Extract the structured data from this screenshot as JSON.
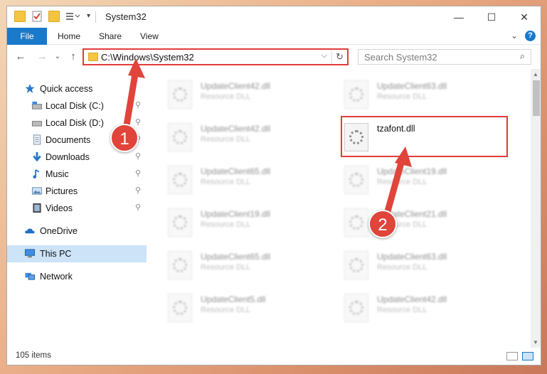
{
  "window": {
    "title": "System32",
    "controls": {
      "minimize": "—",
      "maximize": "☐",
      "close": "✕"
    }
  },
  "ribbon": {
    "file": "File",
    "tabs": [
      "Home",
      "Share",
      "View"
    ],
    "expand": "⌄",
    "help": "?"
  },
  "address_bar": {
    "path": "C:\\Windows\\System32",
    "dropdown": "⌵",
    "refresh": "↻"
  },
  "nav_buttons": {
    "back": "←",
    "forward": "→",
    "recent": "⌄",
    "up": "↑"
  },
  "search": {
    "placeholder": "Search System32",
    "icon": "⌕"
  },
  "sidebar": {
    "pin_glyph": "📌",
    "items": [
      {
        "label": "Quick access",
        "icon": "star-icon",
        "pinned": false
      },
      {
        "label": "Local Disk (C:)",
        "icon": "drive-icon",
        "pinned": true
      },
      {
        "label": "Local Disk (D:)",
        "icon": "drive-icon",
        "pinned": true
      },
      {
        "label": "Documents",
        "icon": "documents-icon",
        "pinned": true
      },
      {
        "label": "Downloads",
        "icon": "download-icon",
        "pinned": true
      },
      {
        "label": "Music",
        "icon": "music-icon",
        "pinned": true
      },
      {
        "label": "Pictures",
        "icon": "pictures-icon",
        "pinned": true
      },
      {
        "label": "Videos",
        "icon": "videos-icon",
        "pinned": true
      },
      {
        "label": "OneDrive",
        "icon": "cloud-icon",
        "pinned": false
      },
      {
        "label": "This PC",
        "icon": "computer-icon",
        "pinned": false,
        "selected": true
      },
      {
        "label": "Network",
        "icon": "network-icon",
        "pinned": false
      }
    ]
  },
  "files": {
    "left_column": [
      {
        "name": "UpdateClient42.dll",
        "type": "Resource DLL"
      },
      {
        "name": "UpdateClient42.dll",
        "type": "Resource DLL"
      },
      {
        "name": "UpdateClient65.dll",
        "type": "Resource DLL"
      },
      {
        "name": "UpdateClient19.dll",
        "type": "Resource DLL"
      },
      {
        "name": "UpdateClient65.dll",
        "type": "Resource DLL"
      },
      {
        "name": "UpdateClient5.dll",
        "type": "Resource DLL"
      }
    ],
    "right_column": [
      {
        "name": "UpdateClient63.dll",
        "type": "Resource DLL"
      },
      {
        "name": "tzafont.dll",
        "type": "",
        "highlighted": true
      },
      {
        "name": "UpdateClient19.dll",
        "type": "Resource DLL"
      },
      {
        "name": "UpdateClient21.dll",
        "type": "Resource DLL"
      },
      {
        "name": "UpdateClient63.dll",
        "type": "Resource DLL"
      },
      {
        "name": "UpdateClient42.dll",
        "type": "Resource DLL"
      }
    ]
  },
  "status_bar": {
    "item_count": "105 items"
  },
  "annotations": {
    "step1": "1",
    "step2": "2",
    "color": "#e0443a"
  },
  "colors": {
    "accent": "#1979ca",
    "highlight_border": "#e23b3b",
    "selected_bg": "#cce3f8"
  }
}
